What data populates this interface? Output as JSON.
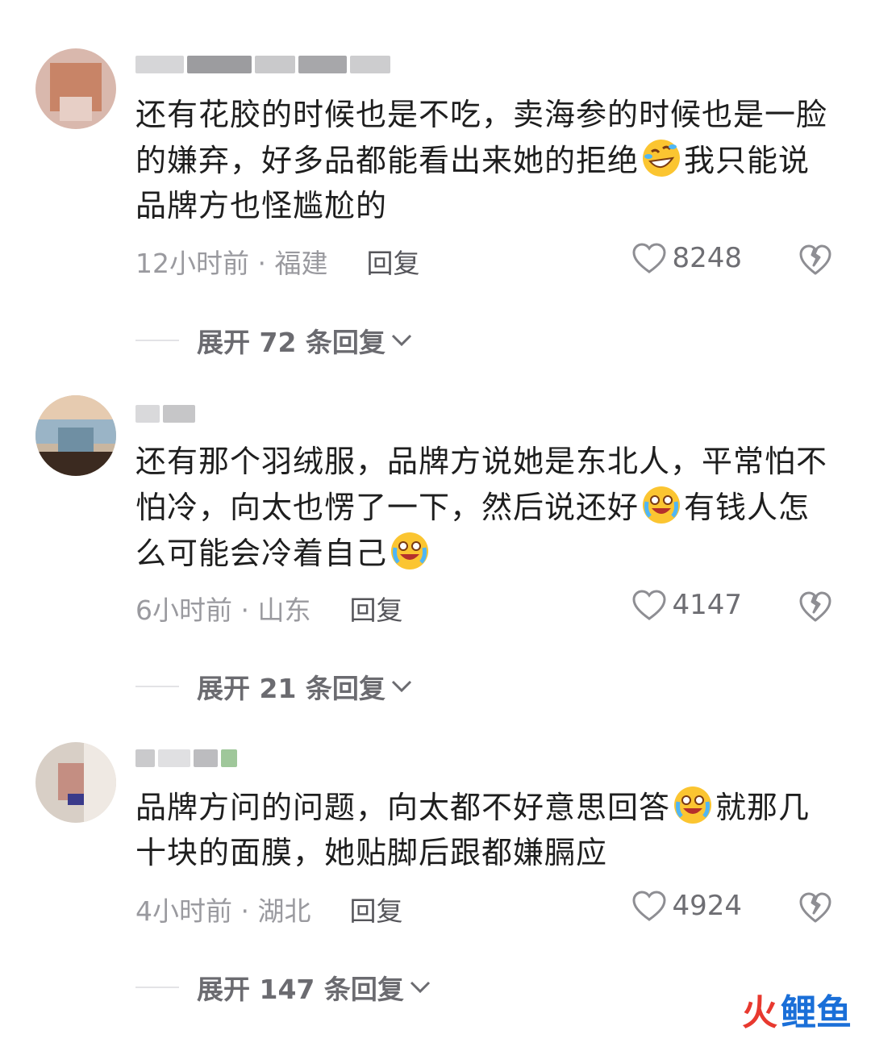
{
  "comments": [
    {
      "text_before": "还有花胶的时候也是不吃，卖海参的时候也是一脸的嫌弃，好多品都能看出来她的拒绝",
      "emoji": "rolling-laughing-emoji",
      "text_after": "我只能说品牌方也怪尴尬的",
      "time": "12小时前 · 福建",
      "reply_label": "回复",
      "likes": "8248",
      "expand_label": "展开 72 条回复"
    },
    {
      "text_before": "还有那个羽绒服，品牌方说她是东北人，平常怕不怕冷，向太也愣了一下，然后说还好",
      "emoji": "crying-laughing-emoji",
      "text_middle": "有钱人怎么可能会冷着自己",
      "emoji2": "crying-laughing-emoji",
      "time": "6小时前 · 山东",
      "reply_label": "回复",
      "likes": "4147",
      "expand_label": "展开 21 条回复"
    },
    {
      "text_before": "品牌方问的问题，向太都不好意思回答",
      "emoji": "crying-laughing-emoji",
      "text_after": "就那几十块的面膜，她贴脚后跟都嫌膈应",
      "time": "4小时前 · 湖北",
      "reply_label": "回复",
      "likes": "4924",
      "expand_label": "展开 147 条回复"
    }
  ],
  "watermark": {
    "fire": "火",
    "carp": "鲤鱼"
  },
  "colors": {
    "meta": "#9a9a9f",
    "text": "#1e1e1e",
    "expand": "#6b6b70"
  }
}
